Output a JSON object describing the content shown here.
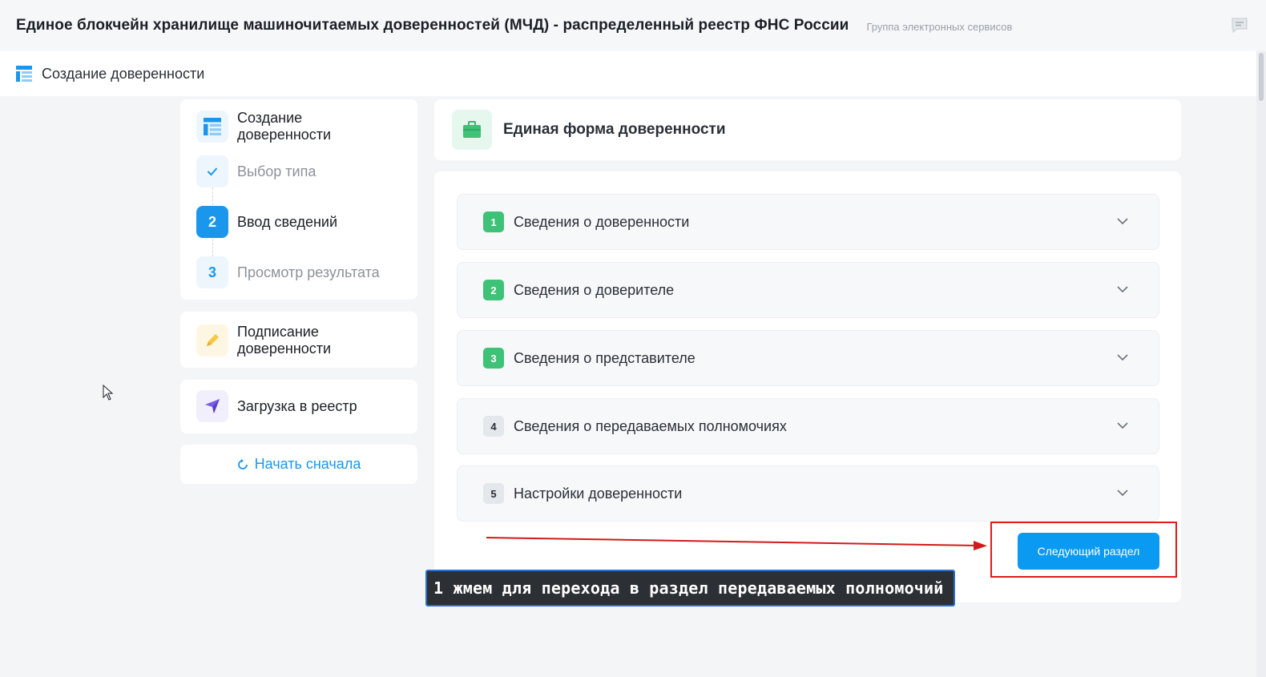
{
  "header": {
    "title": "Единое блокчейн хранилище машиночитаемых доверенностей (МЧД) - распределенный реестр ФНС России",
    "subtitle": "Группа электронных сервисов"
  },
  "subheader": {
    "label": "Создание доверенности"
  },
  "sidebar": {
    "creation": {
      "title": "Создание доверенности",
      "steps": [
        {
          "marker": "",
          "label": "Выбор типа",
          "state": "done"
        },
        {
          "marker": "2",
          "label": "Ввод сведений",
          "state": "active"
        },
        {
          "marker": "3",
          "label": "Просмотр результата",
          "state": "pending"
        }
      ]
    },
    "signing": {
      "title": "Подписание доверенности"
    },
    "upload": {
      "title": "Загрузка в реестр"
    },
    "restart_label": "Начать сначала"
  },
  "form": {
    "title": "Единая форма доверенности",
    "sections": [
      {
        "num": "1",
        "label": "Сведения о доверенности",
        "status": "complete"
      },
      {
        "num": "2",
        "label": "Сведения о доверителе",
        "status": "complete"
      },
      {
        "num": "3",
        "label": "Сведения о представителе",
        "status": "complete"
      },
      {
        "num": "4",
        "label": "Сведения о передаваемых полномочиях",
        "status": "incomplete"
      },
      {
        "num": "5",
        "label": "Настройки доверенности",
        "status": "incomplete"
      }
    ],
    "next_button": "Следующий раздел"
  },
  "annotation": {
    "text": "1 жмем для перехода в раздел передаваемых полномочий"
  },
  "colors": {
    "accent": "#0a9af1",
    "complete": "#3ec277",
    "annotation_red": "#e01b1b"
  }
}
